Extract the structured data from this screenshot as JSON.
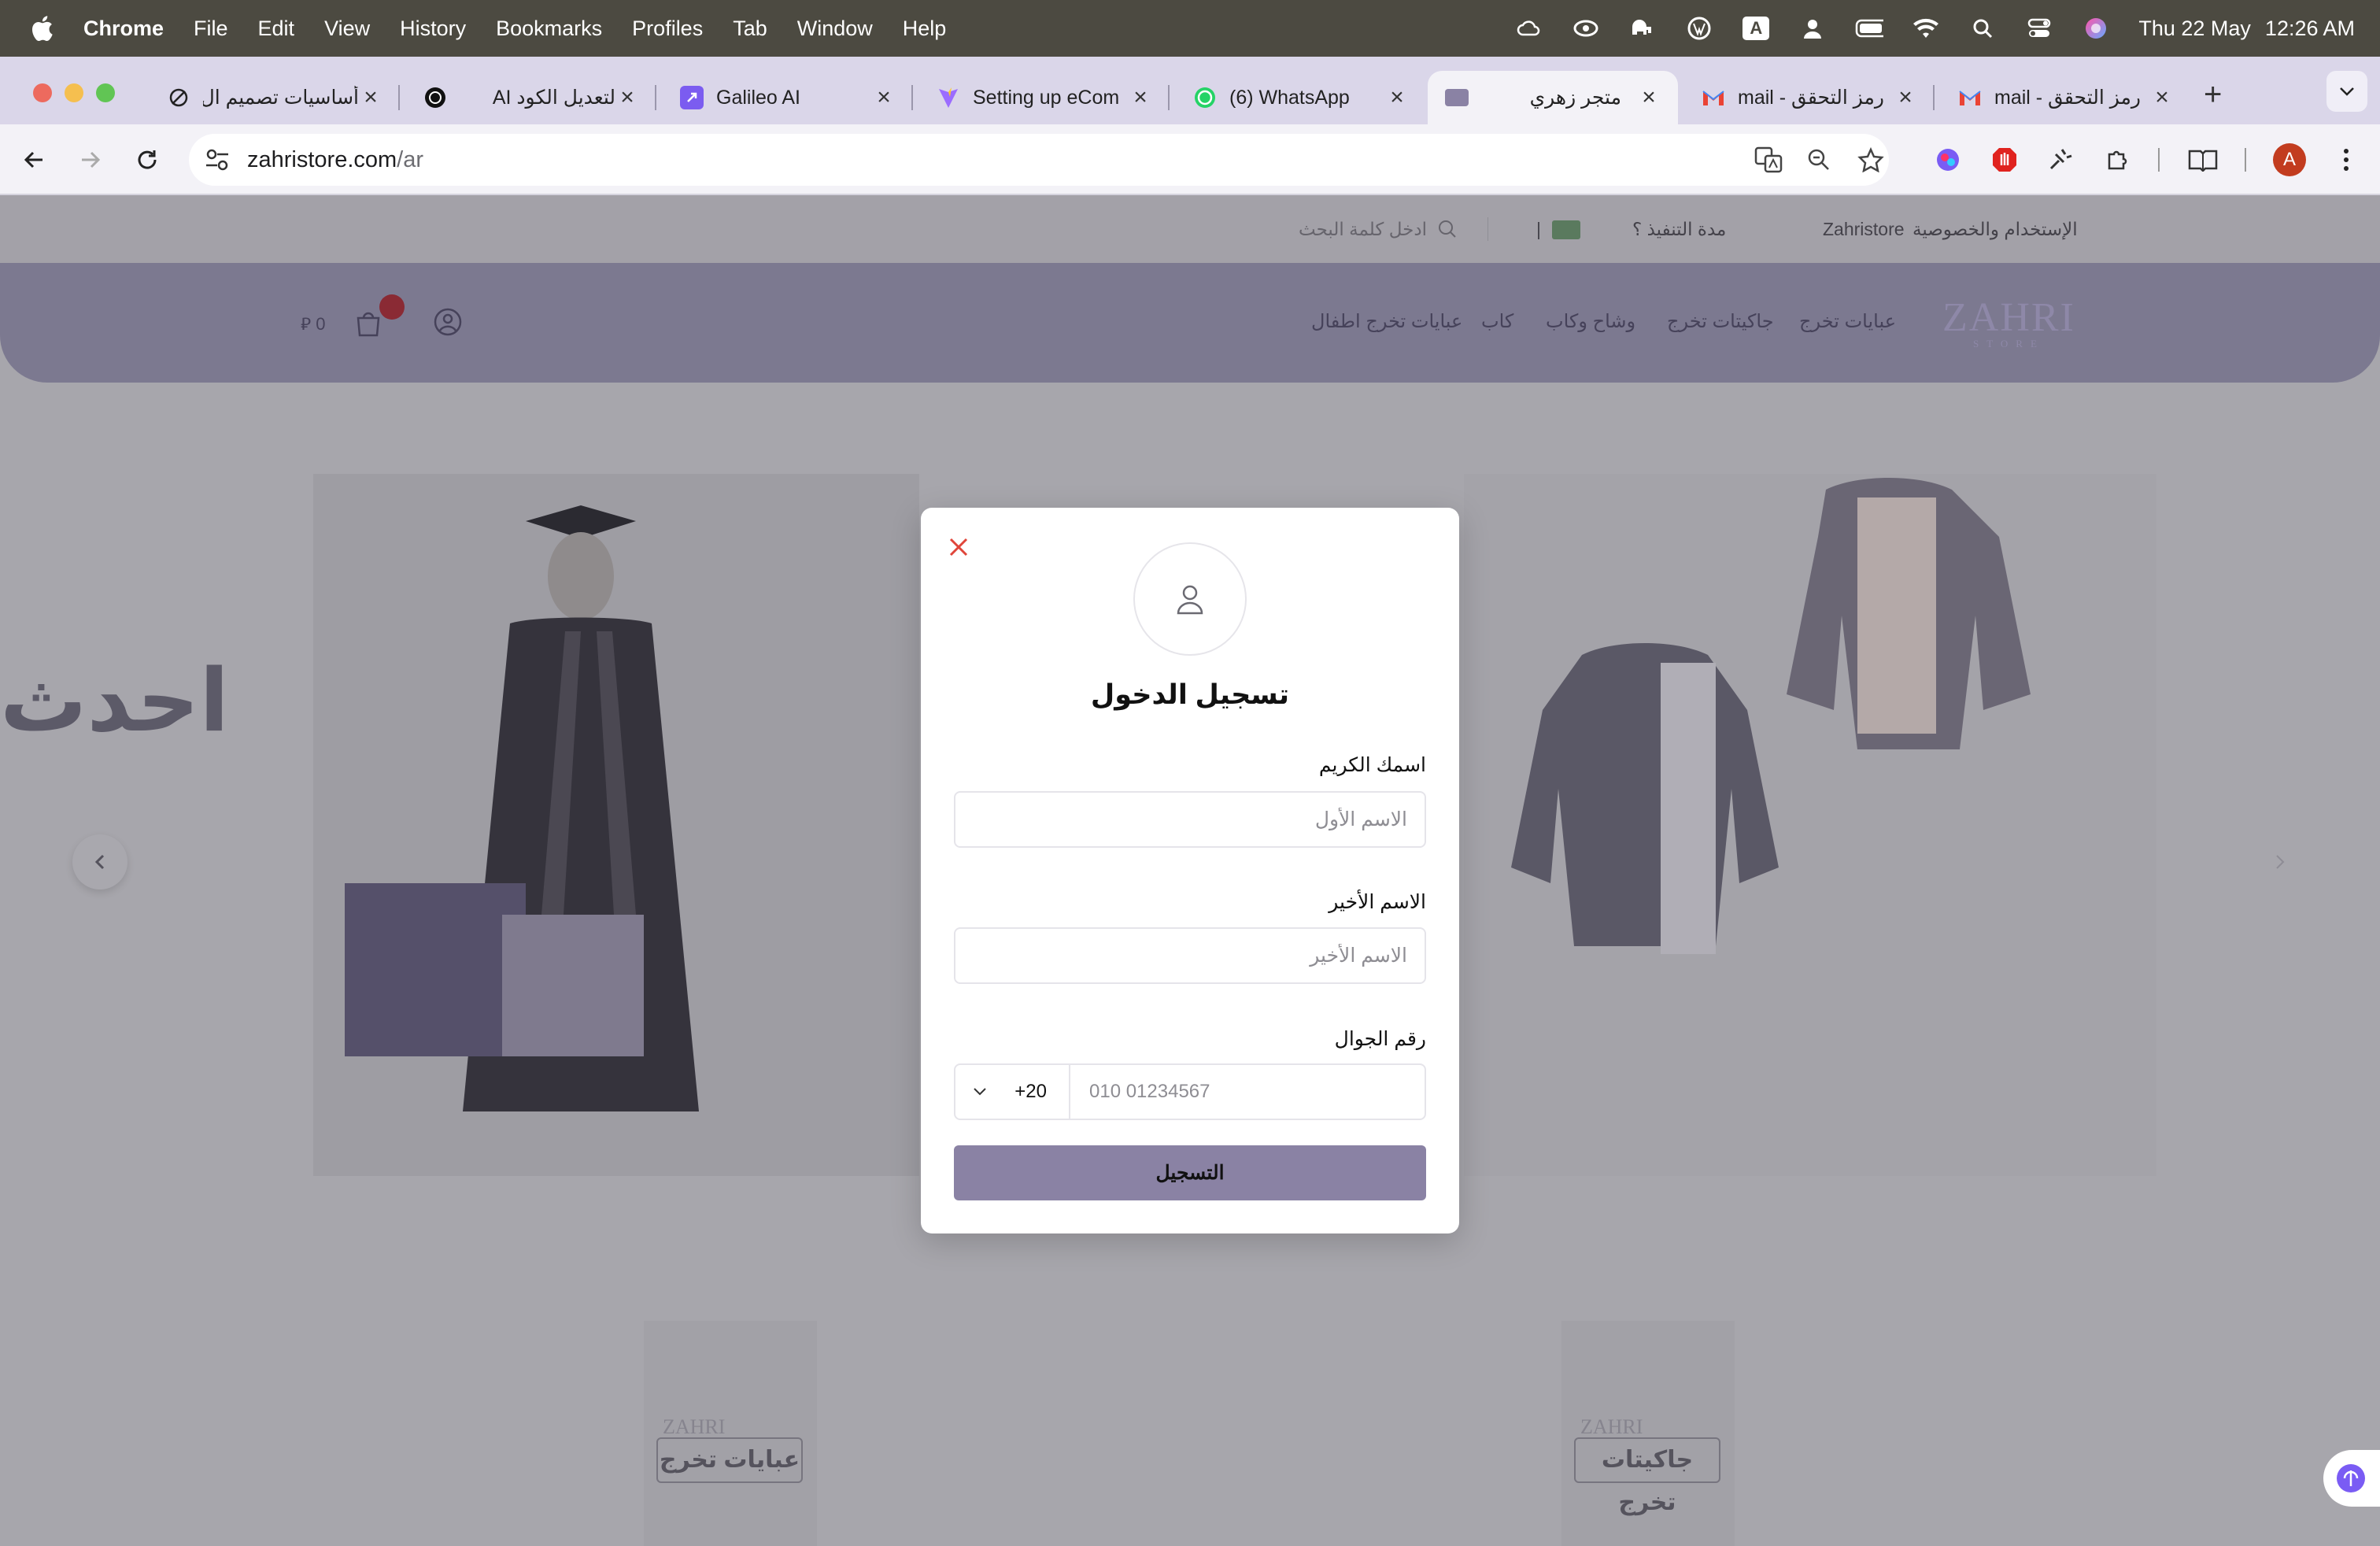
{
  "menubar": {
    "app": "Chrome",
    "items": [
      "File",
      "Edit",
      "View",
      "History",
      "Bookmarks",
      "Profiles",
      "Tab",
      "Window",
      "Help"
    ],
    "date": "Thu 22 May",
    "time": "12:26 AM",
    "input_source": "A"
  },
  "tabs": [
    {
      "title": "أساسيات تصميم ال",
      "icon": "ai-tool-icon"
    },
    {
      "title": "لتعديل الكود AI",
      "icon": "openai-icon"
    },
    {
      "title": "Galileo AI",
      "icon": "galileo-icon"
    },
    {
      "title": "Setting up eCom",
      "icon": "vite-icon"
    },
    {
      "title": "(6) WhatsApp",
      "icon": "whatsapp-icon"
    },
    {
      "title": "متجر زهري",
      "icon": "zahri-favicon",
      "active": true
    },
    {
      "title": "رمز التحقق - mail",
      "icon": "gmail-icon"
    },
    {
      "title": "رمز التحقق - mail",
      "icon": "gmail-icon"
    }
  ],
  "browser": {
    "url_host": "zahristore.com",
    "url_path": "/ar",
    "profile_initial": "A"
  },
  "site": {
    "topbar": {
      "terms": "الإستخدام والخصوصية",
      "brand": "Zahristore",
      "delivery": "مدة التنفيذ ؟",
      "currency_sep": "|",
      "search_placeholder": "ادخل كلمة البحث"
    },
    "nav": [
      "عبايات تخرج",
      "جاكيتات تخرج",
      "وشاح وكاب",
      "كاب",
      "عبايات تخرج اطفال"
    ],
    "logo": "ZAHRI",
    "logo_sub": "STORE",
    "cart_total": "0",
    "currency_symbol": "⃁",
    "hero_text": "احدث",
    "categories": [
      "عبايات تخرج",
      "جاكيتات تخرج"
    ],
    "category_watermark": "ZAHRI"
  },
  "modal": {
    "title": "تسجيل الدخول",
    "first_name_label": "اسمك الكريم",
    "first_name_placeholder": "الاسم الأول",
    "last_name_label": "الاسم الأخير",
    "last_name_placeholder": "الاسم الأخير",
    "phone_label": "رقم الجوال",
    "country_code": "+20",
    "phone_placeholder": "010 01234567",
    "submit": "التسجيل"
  },
  "colors": {
    "accent": "#8a82a4",
    "header": "#7c7990",
    "close": "#e0453a"
  }
}
